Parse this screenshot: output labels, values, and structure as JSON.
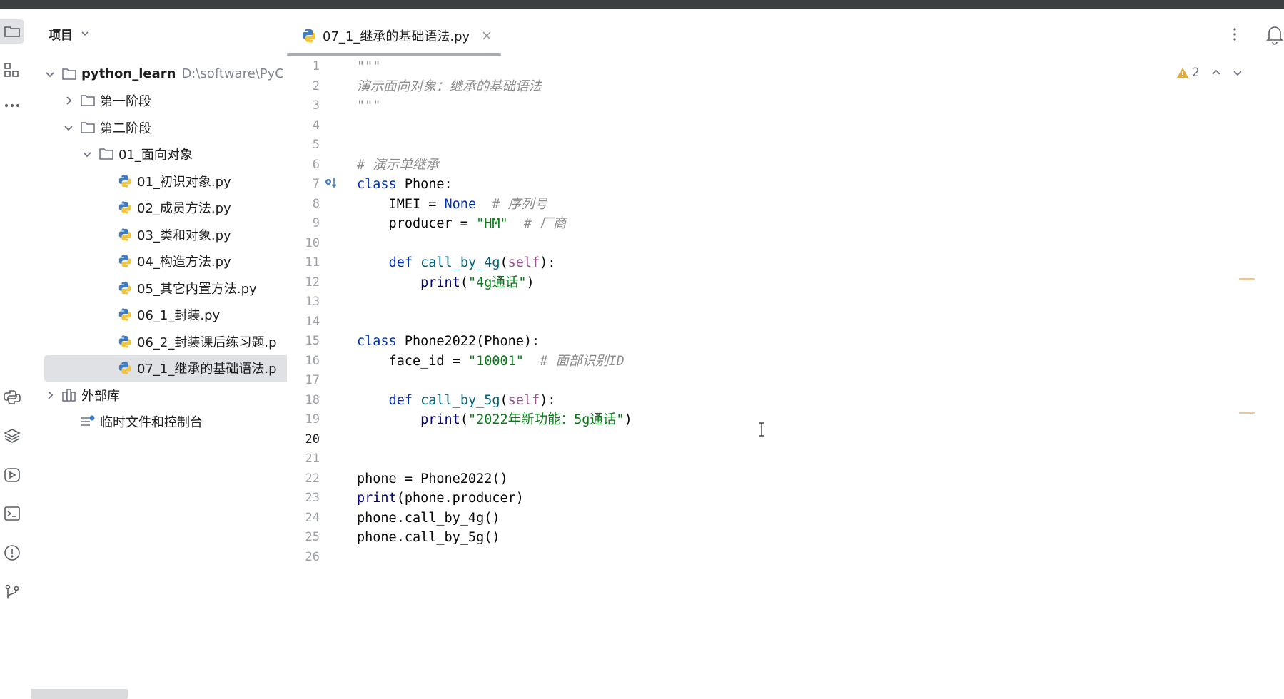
{
  "project": {
    "title": "项目",
    "tree": [
      {
        "label": "python_learn",
        "path": "D:\\software\\PyC",
        "level": 0,
        "type": "folder",
        "expanded": true
      },
      {
        "label": "第一阶段",
        "level": 1,
        "type": "folder",
        "expanded": false
      },
      {
        "label": "第二阶段",
        "level": 1,
        "type": "folder",
        "expanded": true
      },
      {
        "label": "01_面向对象",
        "level": 2,
        "type": "folder",
        "expanded": true
      },
      {
        "label": "01_初识对象.py",
        "level": 3,
        "type": "python"
      },
      {
        "label": "02_成员方法.py",
        "level": 3,
        "type": "python"
      },
      {
        "label": "03_类和对象.py",
        "level": 3,
        "type": "python"
      },
      {
        "label": "04_构造方法.py",
        "level": 3,
        "type": "python"
      },
      {
        "label": "05_其它内置方法.py",
        "level": 3,
        "type": "python"
      },
      {
        "label": "06_1_封装.py",
        "level": 3,
        "type": "python"
      },
      {
        "label": "06_2_封装课后练习题.p",
        "level": 3,
        "type": "python"
      },
      {
        "label": "07_1_继承的基础语法.p",
        "level": 3,
        "type": "python",
        "selected": true
      },
      {
        "label": "外部库",
        "level": 0,
        "type": "library",
        "expanded": false
      },
      {
        "label": "临时文件和控制台",
        "level": 0,
        "type": "scratch"
      }
    ]
  },
  "editor": {
    "tab_label": "07_1_继承的基础语法.py",
    "warning_count": "2",
    "current_line": 20,
    "lines": [
      [
        [
          "cm",
          "\"\"\""
        ]
      ],
      [
        [
          "cm",
          "演示面向对象：继承的基础语法"
        ]
      ],
      [
        [
          "cm",
          "\"\"\""
        ]
      ],
      [],
      [],
      [
        [
          "cm",
          "# 演示单继承"
        ]
      ],
      [
        [
          "kw",
          "class"
        ],
        [
          "",
          " Phone:"
        ]
      ],
      [
        [
          "",
          "    IMEI = "
        ],
        [
          "kw",
          "None"
        ],
        [
          "",
          "  "
        ],
        [
          "cm",
          "# 序列号"
        ]
      ],
      [
        [
          "",
          "    producer = "
        ],
        [
          "st",
          "\"HM\""
        ],
        [
          "",
          "  "
        ],
        [
          "cm",
          "# 厂商"
        ]
      ],
      [],
      [
        [
          "",
          "    "
        ],
        [
          "kw",
          "def"
        ],
        [
          "",
          " "
        ],
        [
          "fn",
          "call_by_4g"
        ],
        [
          "",
          "("
        ],
        [
          "sf",
          "self"
        ],
        [
          "",
          "):"
        ]
      ],
      [
        [
          "",
          "        "
        ],
        [
          "bi",
          "print"
        ],
        [
          "",
          "("
        ],
        [
          "st",
          "\"4g通话\""
        ],
        [
          "",
          ")"
        ]
      ],
      [],
      [],
      [
        [
          "kw",
          "class"
        ],
        [
          "",
          " Phone2022(Phone):"
        ]
      ],
      [
        [
          "",
          "    face_id = "
        ],
        [
          "st",
          "\"10001\""
        ],
        [
          "",
          "  "
        ],
        [
          "cm",
          "# 面部识别ID"
        ]
      ],
      [],
      [
        [
          "",
          "    "
        ],
        [
          "kw",
          "def"
        ],
        [
          "",
          " "
        ],
        [
          "fn",
          "call_by_5g"
        ],
        [
          "",
          "("
        ],
        [
          "sf",
          "self"
        ],
        [
          "",
          "):"
        ]
      ],
      [
        [
          "",
          "        "
        ],
        [
          "bi",
          "print"
        ],
        [
          "",
          "("
        ],
        [
          "st",
          "\"2022年新功能：5g通话\""
        ],
        [
          "",
          ")"
        ]
      ],
      [],
      [],
      [
        [
          "",
          "phone = Phone2022()"
        ]
      ],
      [
        [
          "bi",
          "print"
        ],
        [
          "",
          "(phone.producer)"
        ]
      ],
      [
        [
          "",
          "phone.call_by_4g()"
        ]
      ],
      [
        [
          "",
          "phone.call_by_5g()"
        ]
      ],
      []
    ]
  },
  "icons": {
    "toolstrip": [
      "folder-icon",
      "structure-icon",
      "more-icon",
      "python-console-icon",
      "layers-icon",
      "run-icon",
      "terminal-icon",
      "problems-icon",
      "git-icon"
    ]
  }
}
